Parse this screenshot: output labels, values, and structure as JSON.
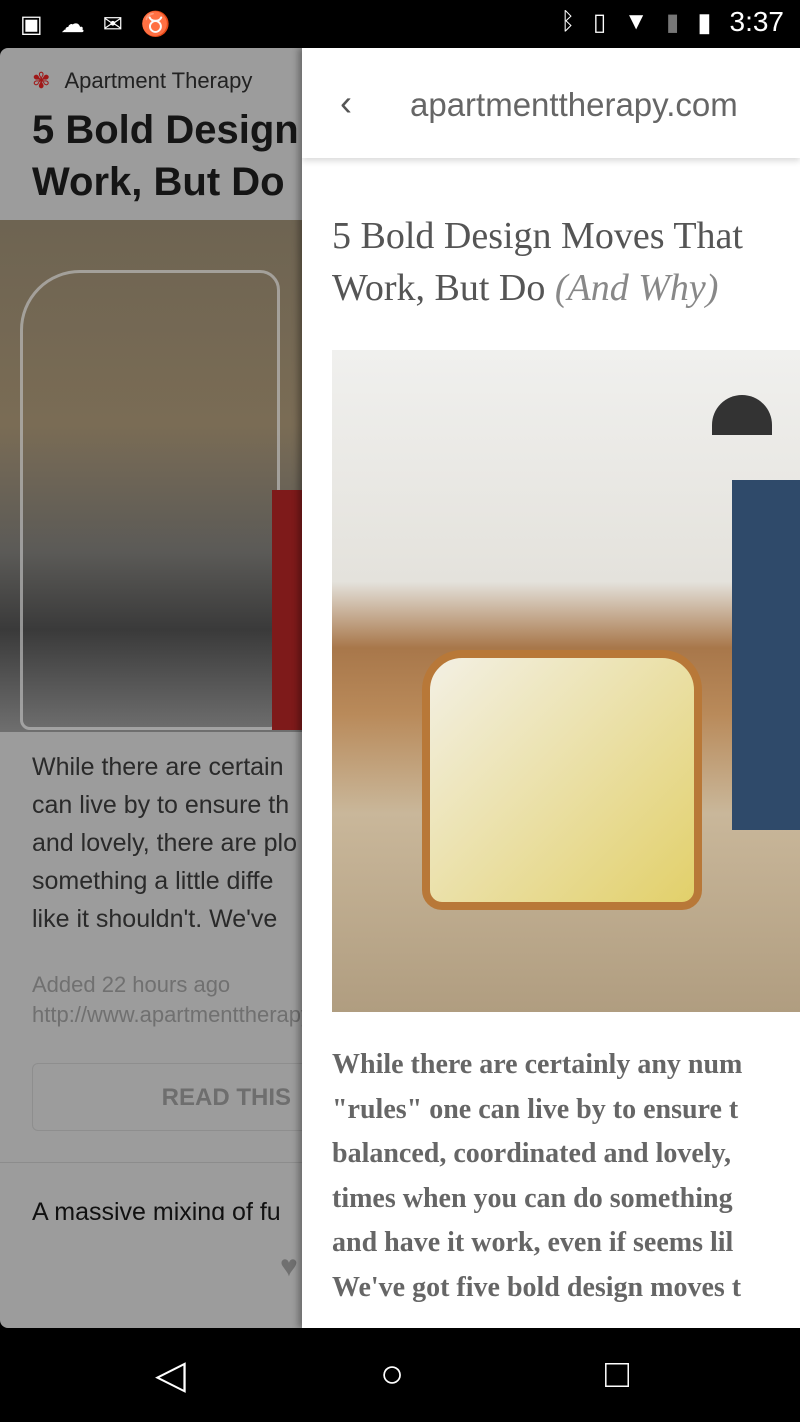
{
  "status_bar": {
    "time": "3:37",
    "left_icons": [
      "image-icon",
      "cloud-upload-icon",
      "gmail-icon",
      "android-icon"
    ],
    "right_icons": [
      "bluetooth-icon",
      "vibrate-icon",
      "wifi-icon",
      "no-sim-icon",
      "battery-icon"
    ]
  },
  "card": {
    "source": "Apartment Therapy",
    "title_lines": [
      "5 Bold Design",
      "Work, But Do"
    ],
    "body_lines": [
      "While there are certain",
      "can live by to ensure th",
      "and lovely, there are plo",
      "something a little diffe",
      "like it shouldn't. We've"
    ],
    "added": "Added 22 hours ago",
    "link": "http://www.apartmenttherapy",
    "read_button": "READ THIS",
    "next_preview": "A massive mixing of fu"
  },
  "reader": {
    "url": "apartmenttherapy.com",
    "title_line1": "5 Bold Design Moves That",
    "title_line2": "Work, But Do ",
    "title_italic": "(And Why)",
    "body_lines": [
      "While there are certainly any num",
      "\"rules\" one can live by to ensure t",
      "balanced, coordinated and lovely,",
      "times when you can do something",
      "and have it work, even if seems lil",
      "We've got five bold design moves t"
    ]
  }
}
